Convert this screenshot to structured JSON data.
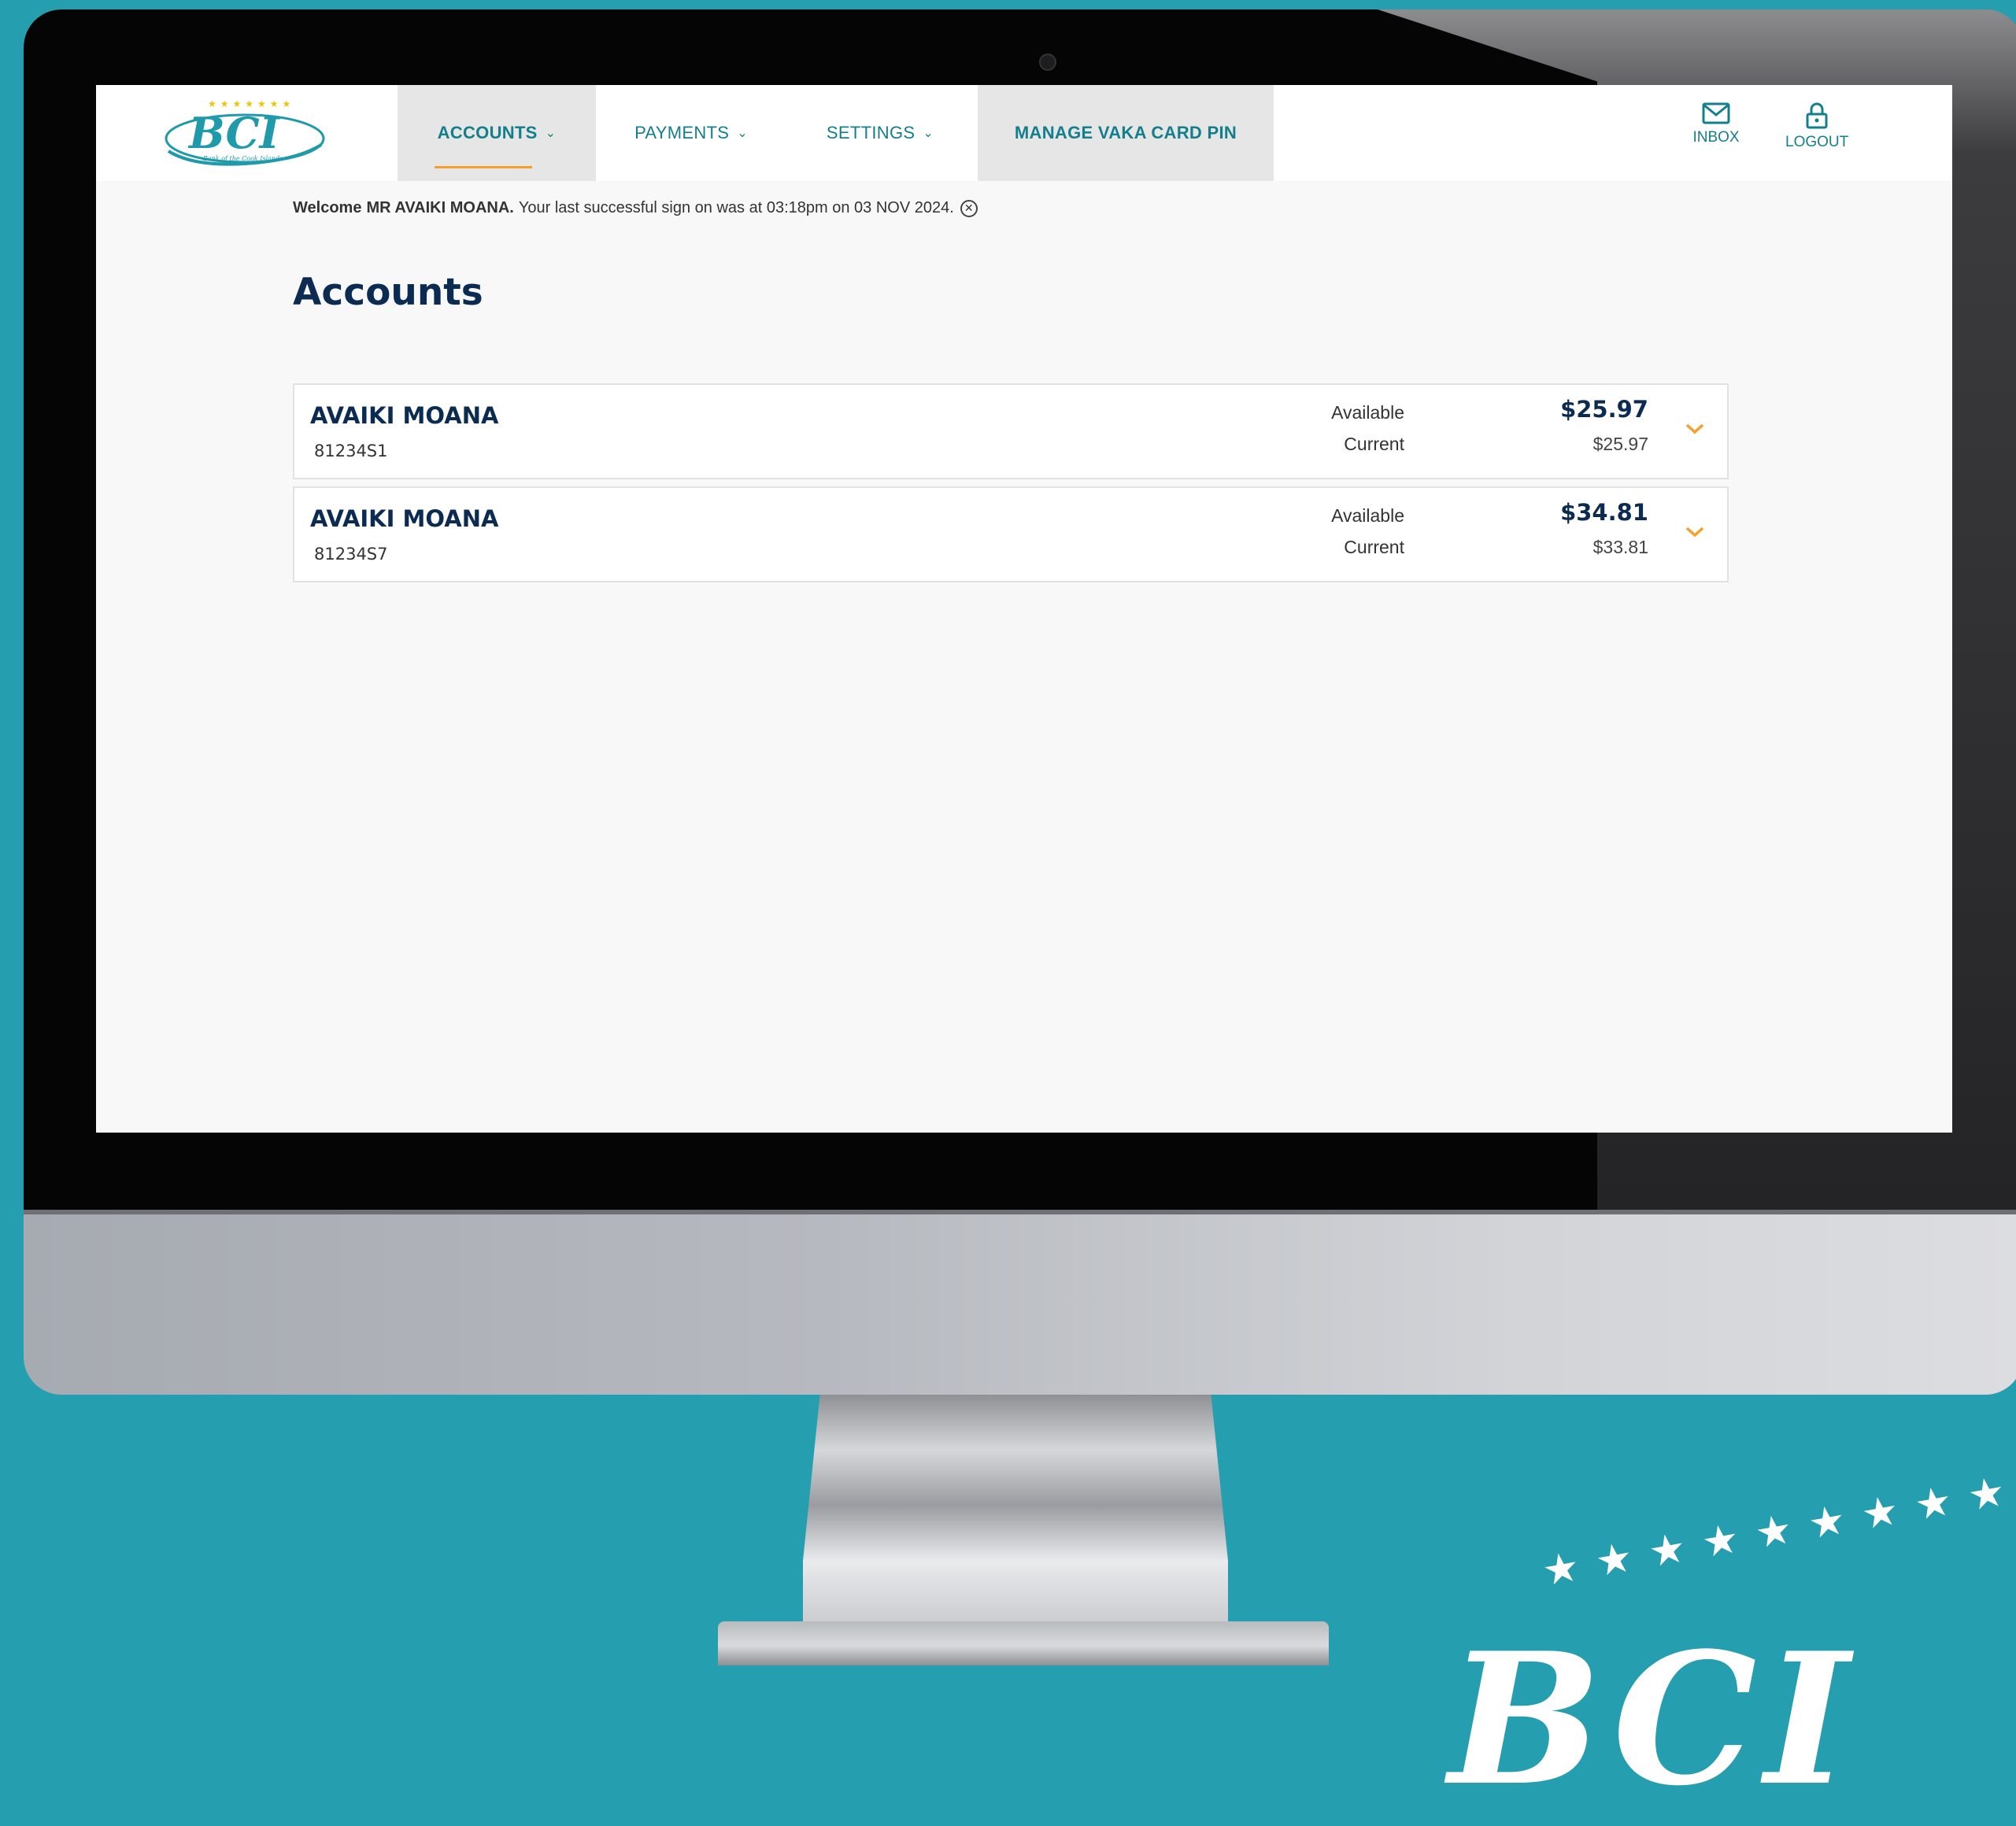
{
  "nav": {
    "logo_text": "BCI",
    "logo_subtext": "Bank of the Cook Islands",
    "items": [
      {
        "label": "ACCOUNTS"
      },
      {
        "label": "PAYMENTS"
      },
      {
        "label": "SETTINGS"
      },
      {
        "label": "MANAGE VAKA CARD PIN"
      }
    ],
    "inbox_label": "INBOX",
    "logout_label": "LOGOUT"
  },
  "welcome": {
    "prefix": "Welcome",
    "name": "MR AVAIKI MOANA.",
    "message": "Your last successful sign on was at 03:18pm on 03 NOV 2024."
  },
  "page": {
    "title": "Accounts"
  },
  "accounts": [
    {
      "name": "AVAIKI MOANA",
      "number": "81234S1",
      "available_label": "Available",
      "current_label": "Current",
      "available": "$25.97",
      "current": "$25.97"
    },
    {
      "name": "AVAIKI MOANA",
      "number": "81234S7",
      "available_label": "Available",
      "current_label": "Current",
      "available": "$34.81",
      "current": "$33.81"
    }
  ],
  "background": {
    "logo_text": "BCI"
  },
  "colors": {
    "brand_teal": "#137f8c",
    "navy": "#0b2b52",
    "accent_orange": "#f5a02b",
    "backdrop": "#259eb0"
  }
}
